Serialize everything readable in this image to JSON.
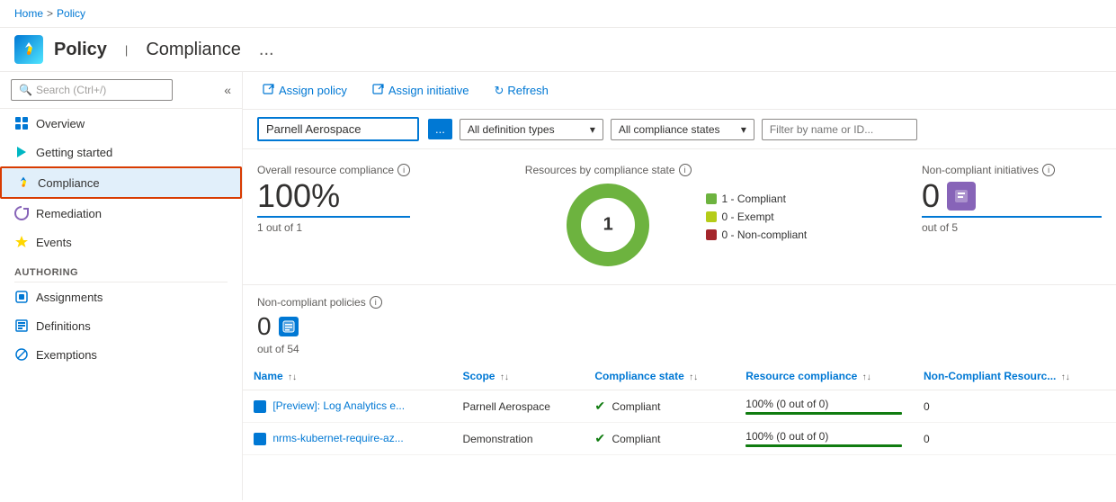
{
  "breadcrumb": {
    "home": "Home",
    "separator": ">",
    "policy": "Policy"
  },
  "header": {
    "icon_text": "🚀",
    "title": "Policy",
    "separator": "|",
    "subtitle": "Compliance",
    "ellipsis": "..."
  },
  "sidebar": {
    "search_placeholder": "Search (Ctrl+/)",
    "collapse_icon": "«",
    "nav_items": [
      {
        "id": "overview",
        "label": "Overview",
        "icon": "○"
      },
      {
        "id": "getting-started",
        "label": "Getting started",
        "icon": "◈"
      },
      {
        "id": "compliance",
        "label": "Compliance",
        "icon": "🚀",
        "active": true
      }
    ],
    "section_label": "Authoring",
    "authoring_items": [
      {
        "id": "assignments",
        "label": "Assignments",
        "icon": "⊡"
      },
      {
        "id": "definitions",
        "label": "Definitions",
        "icon": "⊞"
      },
      {
        "id": "exemptions",
        "label": "Exemptions",
        "icon": "⊘"
      }
    ]
  },
  "toolbar": {
    "assign_policy_label": "Assign policy",
    "assign_policy_icon": "→",
    "assign_initiative_label": "Assign initiative",
    "assign_initiative_icon": "→",
    "refresh_label": "Refresh",
    "refresh_icon": "↻"
  },
  "filters": {
    "scope_value": "Parnell Aerospace",
    "scope_btn_label": "...",
    "definition_types_label": "All definition types",
    "compliance_states_label": "All compliance states",
    "filter_placeholder": "Filter by name or ID..."
  },
  "stats": {
    "overall_label": "Overall resource compliance",
    "overall_value": "100%",
    "overall_sub": "1 out of 1",
    "chart_label": "Resources by compliance state",
    "chart_center": "1",
    "legend": [
      {
        "label": "1 - Compliant",
        "color": "#6db33f"
      },
      {
        "label": "0 - Exempt",
        "color": "#b5cc18"
      },
      {
        "label": "0 - Non-compliant",
        "color": "#a4262c"
      }
    ],
    "initiatives_label": "Non-compliant initiatives",
    "initiatives_value": "0",
    "initiatives_sub": "out of 5"
  },
  "policies": {
    "label": "Non-compliant policies",
    "value": "0",
    "sub": "out of 54"
  },
  "table": {
    "columns": [
      {
        "id": "name",
        "label": "Name"
      },
      {
        "id": "scope",
        "label": "Scope"
      },
      {
        "id": "compliance_state",
        "label": "Compliance state"
      },
      {
        "id": "resource_compliance",
        "label": "Resource compliance"
      },
      {
        "id": "non_compliant",
        "label": "Non-Compliant Resourc..."
      }
    ],
    "rows": [
      {
        "name": "[Preview]: Log Analytics e...",
        "scope": "Parnell Aerospace",
        "compliance_state": "Compliant",
        "resource_compliance": "100% (0 out of 0)",
        "non_compliant": "0"
      },
      {
        "name": "nrms-kubernet-require-az...",
        "scope": "Demonstration",
        "compliance_state": "Compliant",
        "resource_compliance": "100% (0 out of 0)",
        "non_compliant": "0"
      }
    ]
  }
}
